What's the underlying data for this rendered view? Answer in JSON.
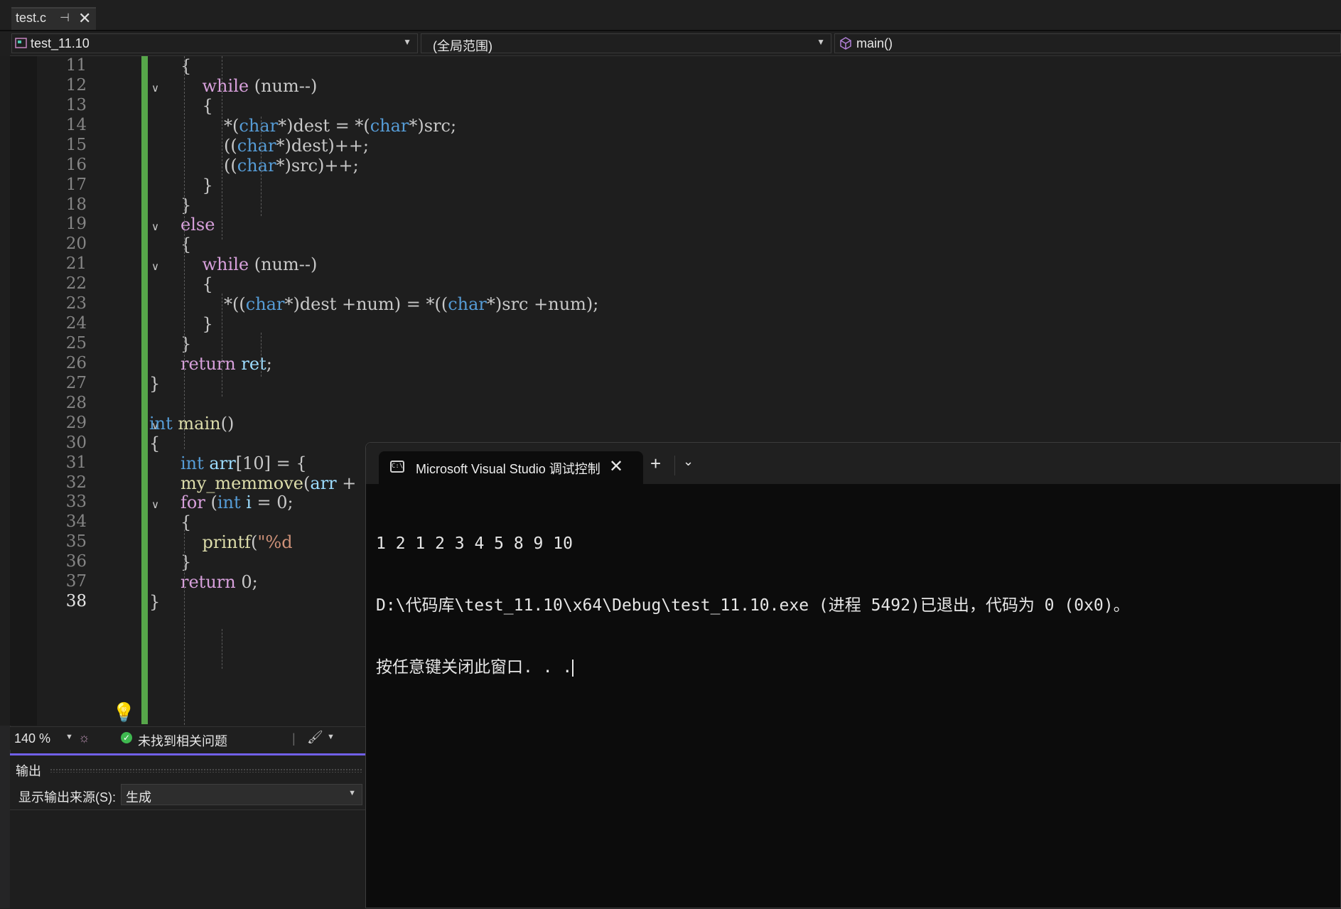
{
  "tab": {
    "filename": "test.c",
    "pin": "⊣",
    "close": "✕"
  },
  "nav": {
    "project": "test_11.10",
    "scope": "(全局范围)",
    "function": "main()"
  },
  "editor": {
    "lines": [
      {
        "n": "11",
        "fold": "",
        "code": [
          {
            "c": "pl",
            "t": "{"
          }
        ]
      },
      {
        "n": "12",
        "fold": "∨",
        "code": [
          {
            "c": "kw",
            "t": "    while"
          },
          {
            "c": "pl",
            "t": " (num--)"
          }
        ]
      },
      {
        "n": "13",
        "fold": "",
        "code": [
          {
            "c": "pl",
            "t": "    {"
          }
        ]
      },
      {
        "n": "14",
        "fold": "",
        "code": [
          {
            "c": "pl",
            "t": "        *("
          },
          {
            "c": "ty",
            "t": "char"
          },
          {
            "c": "pl",
            "t": "*)dest = *("
          },
          {
            "c": "ty",
            "t": "char"
          },
          {
            "c": "pl",
            "t": "*)src;"
          }
        ]
      },
      {
        "n": "15",
        "fold": "",
        "code": [
          {
            "c": "pl",
            "t": "        (("
          },
          {
            "c": "ty",
            "t": "char"
          },
          {
            "c": "pl",
            "t": "*)dest)++;"
          }
        ]
      },
      {
        "n": "16",
        "fold": "",
        "code": [
          {
            "c": "pl",
            "t": "        (("
          },
          {
            "c": "ty",
            "t": "char"
          },
          {
            "c": "pl",
            "t": "*)src)++;"
          }
        ]
      },
      {
        "n": "17",
        "fold": "",
        "code": [
          {
            "c": "pl",
            "t": "    }"
          }
        ]
      },
      {
        "n": "18",
        "fold": "",
        "code": [
          {
            "c": "pl",
            "t": "}"
          }
        ]
      },
      {
        "n": "19",
        "fold": "∨",
        "code": [
          {
            "c": "kw",
            "t": "else"
          }
        ]
      },
      {
        "n": "20",
        "fold": "",
        "code": [
          {
            "c": "pl",
            "t": "{"
          }
        ]
      },
      {
        "n": "21",
        "fold": "∨",
        "code": [
          {
            "c": "kw",
            "t": "    while"
          },
          {
            "c": "pl",
            "t": " (num--)"
          }
        ]
      },
      {
        "n": "22",
        "fold": "",
        "code": [
          {
            "c": "pl",
            "t": "    {"
          }
        ]
      },
      {
        "n": "23",
        "fold": "",
        "code": [
          {
            "c": "pl",
            "t": "        *(("
          },
          {
            "c": "ty",
            "t": "char"
          },
          {
            "c": "pl",
            "t": "*)dest +num) = *(("
          },
          {
            "c": "ty",
            "t": "char"
          },
          {
            "c": "pl",
            "t": "*)src +num);"
          }
        ]
      },
      {
        "n": "24",
        "fold": "",
        "code": [
          {
            "c": "pl",
            "t": "    }"
          }
        ]
      },
      {
        "n": "25",
        "fold": "",
        "code": [
          {
            "c": "pl",
            "t": "}"
          }
        ]
      },
      {
        "n": "26",
        "fold": "",
        "code": [
          {
            "c": "kw",
            "t": "return"
          },
          {
            "c": "pl",
            "t": " "
          },
          {
            "c": "id",
            "t": "ret"
          },
          {
            "c": "pl",
            "t": ";"
          }
        ]
      },
      {
        "n": "27",
        "fold": "",
        "code": [
          {
            "c": "pl",
            "t": "}"
          }
        ],
        "indent": -1
      },
      {
        "n": "28",
        "fold": "",
        "code": []
      },
      {
        "n": "29",
        "fold": "∨",
        "code": [
          {
            "c": "ty",
            "t": "int"
          },
          {
            "c": "pl",
            "t": " "
          },
          {
            "c": "fn",
            "t": "main"
          },
          {
            "c": "pl",
            "t": "()"
          }
        ],
        "indent": -1
      },
      {
        "n": "30",
        "fold": "",
        "code": [
          {
            "c": "pl",
            "t": "{"
          }
        ],
        "indent": -1
      },
      {
        "n": "31",
        "fold": "",
        "code": [
          {
            "c": "ty",
            "t": "int"
          },
          {
            "c": "pl",
            "t": " "
          },
          {
            "c": "id",
            "t": "arr"
          },
          {
            "c": "pl",
            "t": "[10] = {"
          }
        ]
      },
      {
        "n": "32",
        "fold": "",
        "code": [
          {
            "c": "fn",
            "t": "my_memmove"
          },
          {
            "c": "pl",
            "t": "("
          },
          {
            "c": "id",
            "t": "arr"
          },
          {
            "c": "pl",
            "t": " +"
          }
        ]
      },
      {
        "n": "33",
        "fold": "∨",
        "code": [
          {
            "c": "kw",
            "t": "for"
          },
          {
            "c": "pl",
            "t": " ("
          },
          {
            "c": "ty",
            "t": "int"
          },
          {
            "c": "pl",
            "t": " "
          },
          {
            "c": "id",
            "t": "i"
          },
          {
            "c": "pl",
            "t": " = 0;"
          }
        ]
      },
      {
        "n": "34",
        "fold": "",
        "code": [
          {
            "c": "pl",
            "t": "{"
          }
        ]
      },
      {
        "n": "35",
        "fold": "",
        "code": [
          {
            "c": "fn",
            "t": "    printf"
          },
          {
            "c": "pl",
            "t": "("
          },
          {
            "c": "str",
            "t": "\"%d "
          }
        ]
      },
      {
        "n": "36",
        "fold": "",
        "code": [
          {
            "c": "pl",
            "t": "}"
          }
        ]
      },
      {
        "n": "37",
        "fold": "",
        "code": [
          {
            "c": "kw",
            "t": "return"
          },
          {
            "c": "pl",
            "t": " 0;"
          }
        ]
      },
      {
        "n": "38",
        "fold": "",
        "code": [
          {
            "c": "pl",
            "t": "}"
          }
        ],
        "indent": -1,
        "current": true
      }
    ]
  },
  "status": {
    "zoom": "140 %",
    "issues": "未找到相关问题"
  },
  "output": {
    "title": "输出",
    "source_label": "显示输出来源(S):",
    "source_value": "生成"
  },
  "terminal": {
    "tab_title": "Microsoft Visual Studio 调试控制台",
    "plus": "+",
    "lines": [
      "1 2 1 2 3 4 5 8 9 10",
      "D:\\代码库\\test_11.10\\x64\\Debug\\test_11.10.exe (进程 5492)已退出，代码为 0 (0x0)。",
      "按任意键关闭此窗口. . ."
    ]
  },
  "colors": {
    "accent": "#7160e8",
    "change_bar": "#57a64a",
    "keyword": "#d7a0db",
    "type": "#569cd6"
  }
}
